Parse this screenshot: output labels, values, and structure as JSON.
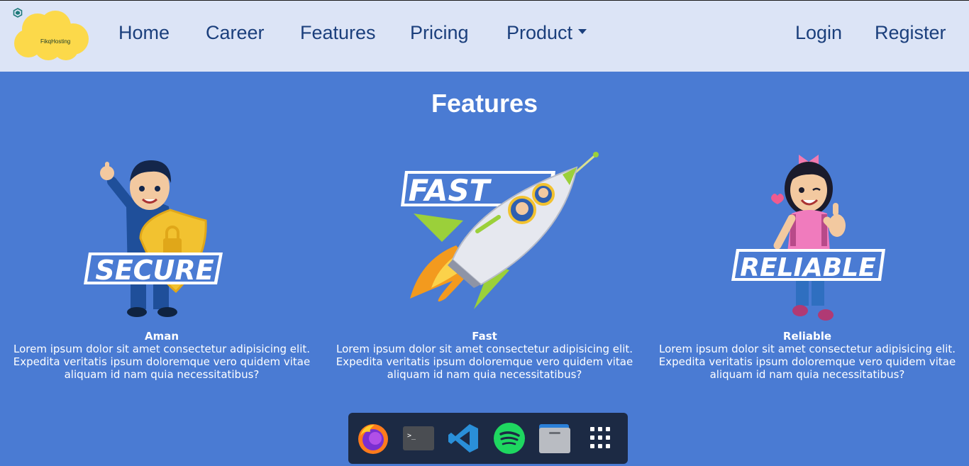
{
  "brand": {
    "name": "FikqHosting"
  },
  "nav": {
    "home": "Home",
    "career": "Career",
    "features": "Features",
    "pricing": "Pricing",
    "product": "Product",
    "login": "Login",
    "register": "Register"
  },
  "section": {
    "title": "Features"
  },
  "features": [
    {
      "badge": "SECURE",
      "title": "Aman",
      "description": "Lorem ipsum dolor sit amet consectetur adipisicing elit. Expedita veritatis ipsum doloremque vero quidem vitae aliquam id nam quia necessitatibus?"
    },
    {
      "badge": "FAST",
      "title": "Fast",
      "description": "Lorem ipsum dolor sit amet consectetur adipisicing elit. Expedita veritatis ipsum doloremque vero quidem vitae aliquam id nam quia necessitatibus?"
    },
    {
      "badge": "RELIABLE",
      "title": "Reliable",
      "description": "Lorem ipsum dolor sit amet consectetur adipisicing elit. Expedita veritatis ipsum doloremque vero quidem vitae aliquam id nam quia necessitatibus?"
    }
  ],
  "dock": {
    "items": [
      "firefox-icon",
      "terminal-icon",
      "vscode-icon",
      "spotify-icon",
      "files-icon",
      "app-grid-icon"
    ],
    "terminal_glyph": ">_"
  },
  "colors": {
    "page_bg": "#4a7bd3",
    "navbar_bg": "#dce4f6",
    "nav_text": "#1b3f7c",
    "dock_bg": "#1c2a44",
    "logo_cloud": "#fcd94a"
  }
}
